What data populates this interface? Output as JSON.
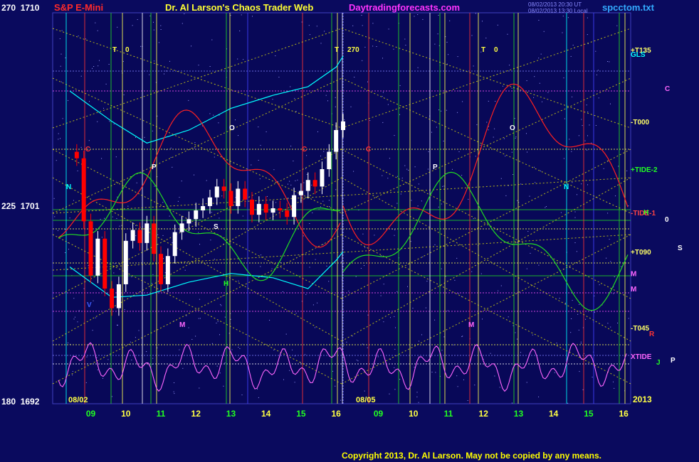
{
  "header": {
    "left_title": "S&P E-Mini",
    "center_title": "Dr. Al Larson's Chaos Trader Web",
    "site": "Daytradingforecasts.com",
    "stamp1": "08/02/2013 20:30 UT",
    "stamp2": "08/02/2013 13:30 Local",
    "file": "spcctom.txt"
  },
  "footer": {
    "copyright": "Copyright 2013, Dr. Al Larson. May not be copied by any means."
  },
  "colors": {
    "background": "#0a0a5e",
    "price_up": "#ffffff",
    "price_down": "#ff0000",
    "trend_lines": "#ffff00",
    "band_upper": "#00ffff",
    "tide": "#ff66ff",
    "equil_red": "#ff2020",
    "equil_green": "#22dd22"
  },
  "chart_data": {
    "type": "candlestick",
    "title": "S&P E-Mini",
    "y_left_labels": [
      {
        "angle": "270",
        "price": "1710"
      },
      {
        "angle": "225",
        "price": "1701"
      },
      {
        "angle": "180",
        "price": "1692"
      }
    ],
    "ylim": [
      1692,
      1710
    ],
    "x_tick_labels": [
      "09",
      "10",
      "11",
      "12",
      "13",
      "14",
      "15",
      "16",
      "09",
      "10",
      "11",
      "12",
      "13",
      "14",
      "15",
      "16"
    ],
    "date_labels": [
      "08/02",
      "08/05",
      "2013"
    ],
    "price_path": [
      [
        8.6,
        1703.3
      ],
      [
        8.8,
        1700.4
      ],
      [
        9.0,
        1697.9
      ],
      [
        9.2,
        1699.6
      ],
      [
        9.4,
        1697.3
      ],
      [
        9.6,
        1696.4
      ],
      [
        9.8,
        1697.5
      ],
      [
        10.0,
        1699.5
      ],
      [
        10.2,
        1700.0
      ],
      [
        10.4,
        1699.4
      ],
      [
        10.6,
        1700.3
      ],
      [
        10.8,
        1698.9
      ],
      [
        11.0,
        1697.5
      ],
      [
        11.2,
        1698.8
      ],
      [
        11.4,
        1699.9
      ],
      [
        11.6,
        1700.3
      ],
      [
        11.8,
        1700.5
      ],
      [
        12.0,
        1700.9
      ],
      [
        12.2,
        1701.1
      ],
      [
        12.4,
        1701.5
      ],
      [
        12.6,
        1702.0
      ],
      [
        12.8,
        1701.8
      ],
      [
        13.0,
        1701.1
      ],
      [
        13.2,
        1701.9
      ],
      [
        13.4,
        1701.4
      ],
      [
        13.6,
        1700.7
      ],
      [
        13.8,
        1701.2
      ],
      [
        14.0,
        1700.8
      ],
      [
        14.2,
        1701.0
      ],
      [
        14.4,
        1700.9
      ],
      [
        14.6,
        1700.6
      ],
      [
        14.8,
        1701.6
      ],
      [
        15.0,
        1701.8
      ],
      [
        15.2,
        1702.3
      ],
      [
        15.4,
        1702.0
      ],
      [
        15.6,
        1702.8
      ],
      [
        15.8,
        1703.6
      ],
      [
        16.0,
        1704.6
      ],
      [
        16.2,
        1705.0
      ]
    ],
    "band_upper": [
      [
        8.4,
        1706.4
      ],
      [
        9.6,
        1705.0
      ],
      [
        10.6,
        1704.0
      ],
      [
        11.8,
        1704.6
      ],
      [
        13.0,
        1705.6
      ],
      [
        14.2,
        1706.2
      ],
      [
        15.2,
        1706.6
      ],
      [
        16.0,
        1707.5
      ],
      [
        16.2,
        1708.0
      ]
    ],
    "band_lower": [
      [
        8.4,
        1698.3
      ],
      [
        9.6,
        1696.9
      ],
      [
        10.6,
        1697.0
      ],
      [
        11.8,
        1697.6
      ],
      [
        13.0,
        1698.0
      ],
      [
        14.2,
        1697.8
      ],
      [
        15.2,
        1697.3
      ],
      [
        16.0,
        1698.6
      ],
      [
        16.2,
        1699.0
      ]
    ],
    "tide_label": "XTIDE",
    "right_labels": [
      {
        "text": "+T135",
        "price": 1708.3,
        "color": "#ffff66"
      },
      {
        "text": "GLS",
        "price": 1708.1,
        "color": "#00ffff"
      },
      {
        "text": "-T000",
        "price": 1705.0,
        "color": "#ffff66"
      },
      {
        "text": "+TIDE-2",
        "price": 1702.8,
        "color": "#22ff22"
      },
      {
        "text": "-TIDE-1",
        "price": 1700.8,
        "color": "#ff4444"
      },
      {
        "text": "+T090",
        "price": 1699.0,
        "color": "#ffff66"
      },
      {
        "text": "M",
        "price": 1698.0,
        "color": "#ff66ff"
      },
      {
        "text": "-T045",
        "price": 1695.5,
        "color": "#ffff66"
      },
      {
        "text": "XTIDE",
        "price": 1694.2,
        "color": "#ff66ff"
      }
    ],
    "planet_labels": [
      "T",
      "0",
      "T",
      "270",
      "T",
      "0",
      "C",
      "O",
      "P",
      "N",
      "H",
      "0",
      "S",
      "M",
      "R",
      "J",
      "P",
      "C",
      "C",
      "C",
      "N",
      "P",
      "O",
      "S",
      "V",
      "M",
      "H",
      "M"
    ],
    "legend": "none",
    "grid": true
  }
}
